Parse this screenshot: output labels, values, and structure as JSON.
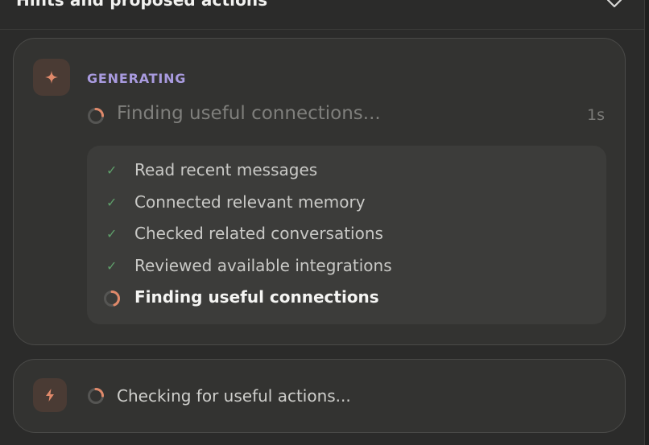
{
  "header": {
    "title": "Hints and proposed actions",
    "collapse_icon": "chevron-down-icon"
  },
  "connections_card": {
    "icon": "sparkle-icon",
    "status_label": "GENERATING",
    "current_task": "Finding useful connections...",
    "elapsed": "1s",
    "steps": [
      {
        "label": "Read recent messages",
        "state": "done"
      },
      {
        "label": "Connected relevant memory",
        "state": "done"
      },
      {
        "label": "Checked related conversations",
        "state": "done"
      },
      {
        "label": "Reviewed available integrations",
        "state": "done"
      },
      {
        "label": "Finding useful connections",
        "state": "in-progress"
      }
    ]
  },
  "actions_card": {
    "icon": "lightning-icon",
    "current_task": "Checking for useful actions..."
  },
  "colors": {
    "accent_orange": "#e0896a",
    "generating_purple": "#a99bdf",
    "check_green": "#5f9f6a",
    "card_bg": "#333331",
    "page_bg": "#2b2b2a"
  }
}
